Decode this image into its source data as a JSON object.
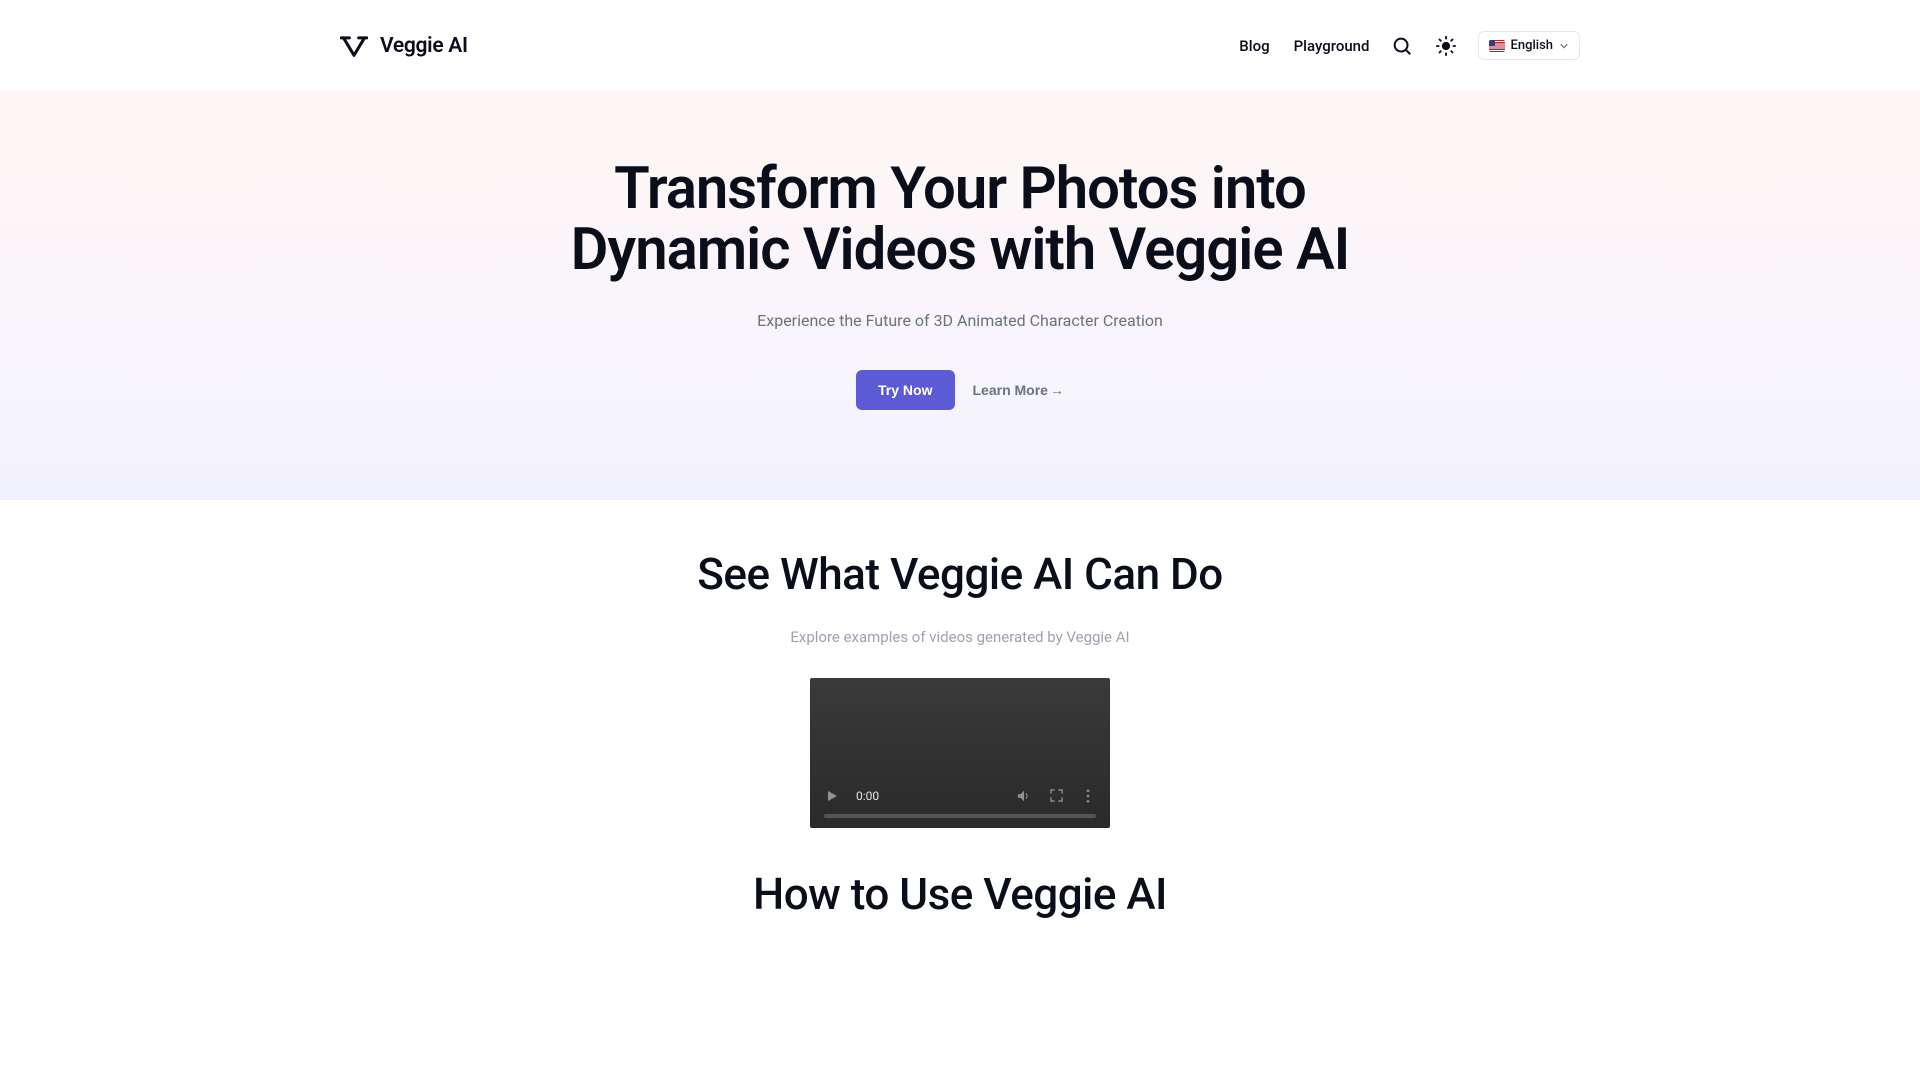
{
  "header": {
    "brand": "Veggie AI",
    "nav": {
      "blog": "Blog",
      "playground": "Playground"
    },
    "lang": {
      "label": "English"
    }
  },
  "hero": {
    "title": "Transform Your Photos into Dynamic Videos with Veggie AI",
    "subtitle": "Experience the Future of 3D Animated Character Creation",
    "cta_primary": "Try Now",
    "cta_secondary": "Learn More"
  },
  "examples": {
    "title": "See What Veggie AI Can Do",
    "subtitle": "Explore examples of videos generated by Veggie AI",
    "video": {
      "time": "0:00"
    }
  },
  "howto": {
    "title": "How to Use Veggie AI"
  }
}
